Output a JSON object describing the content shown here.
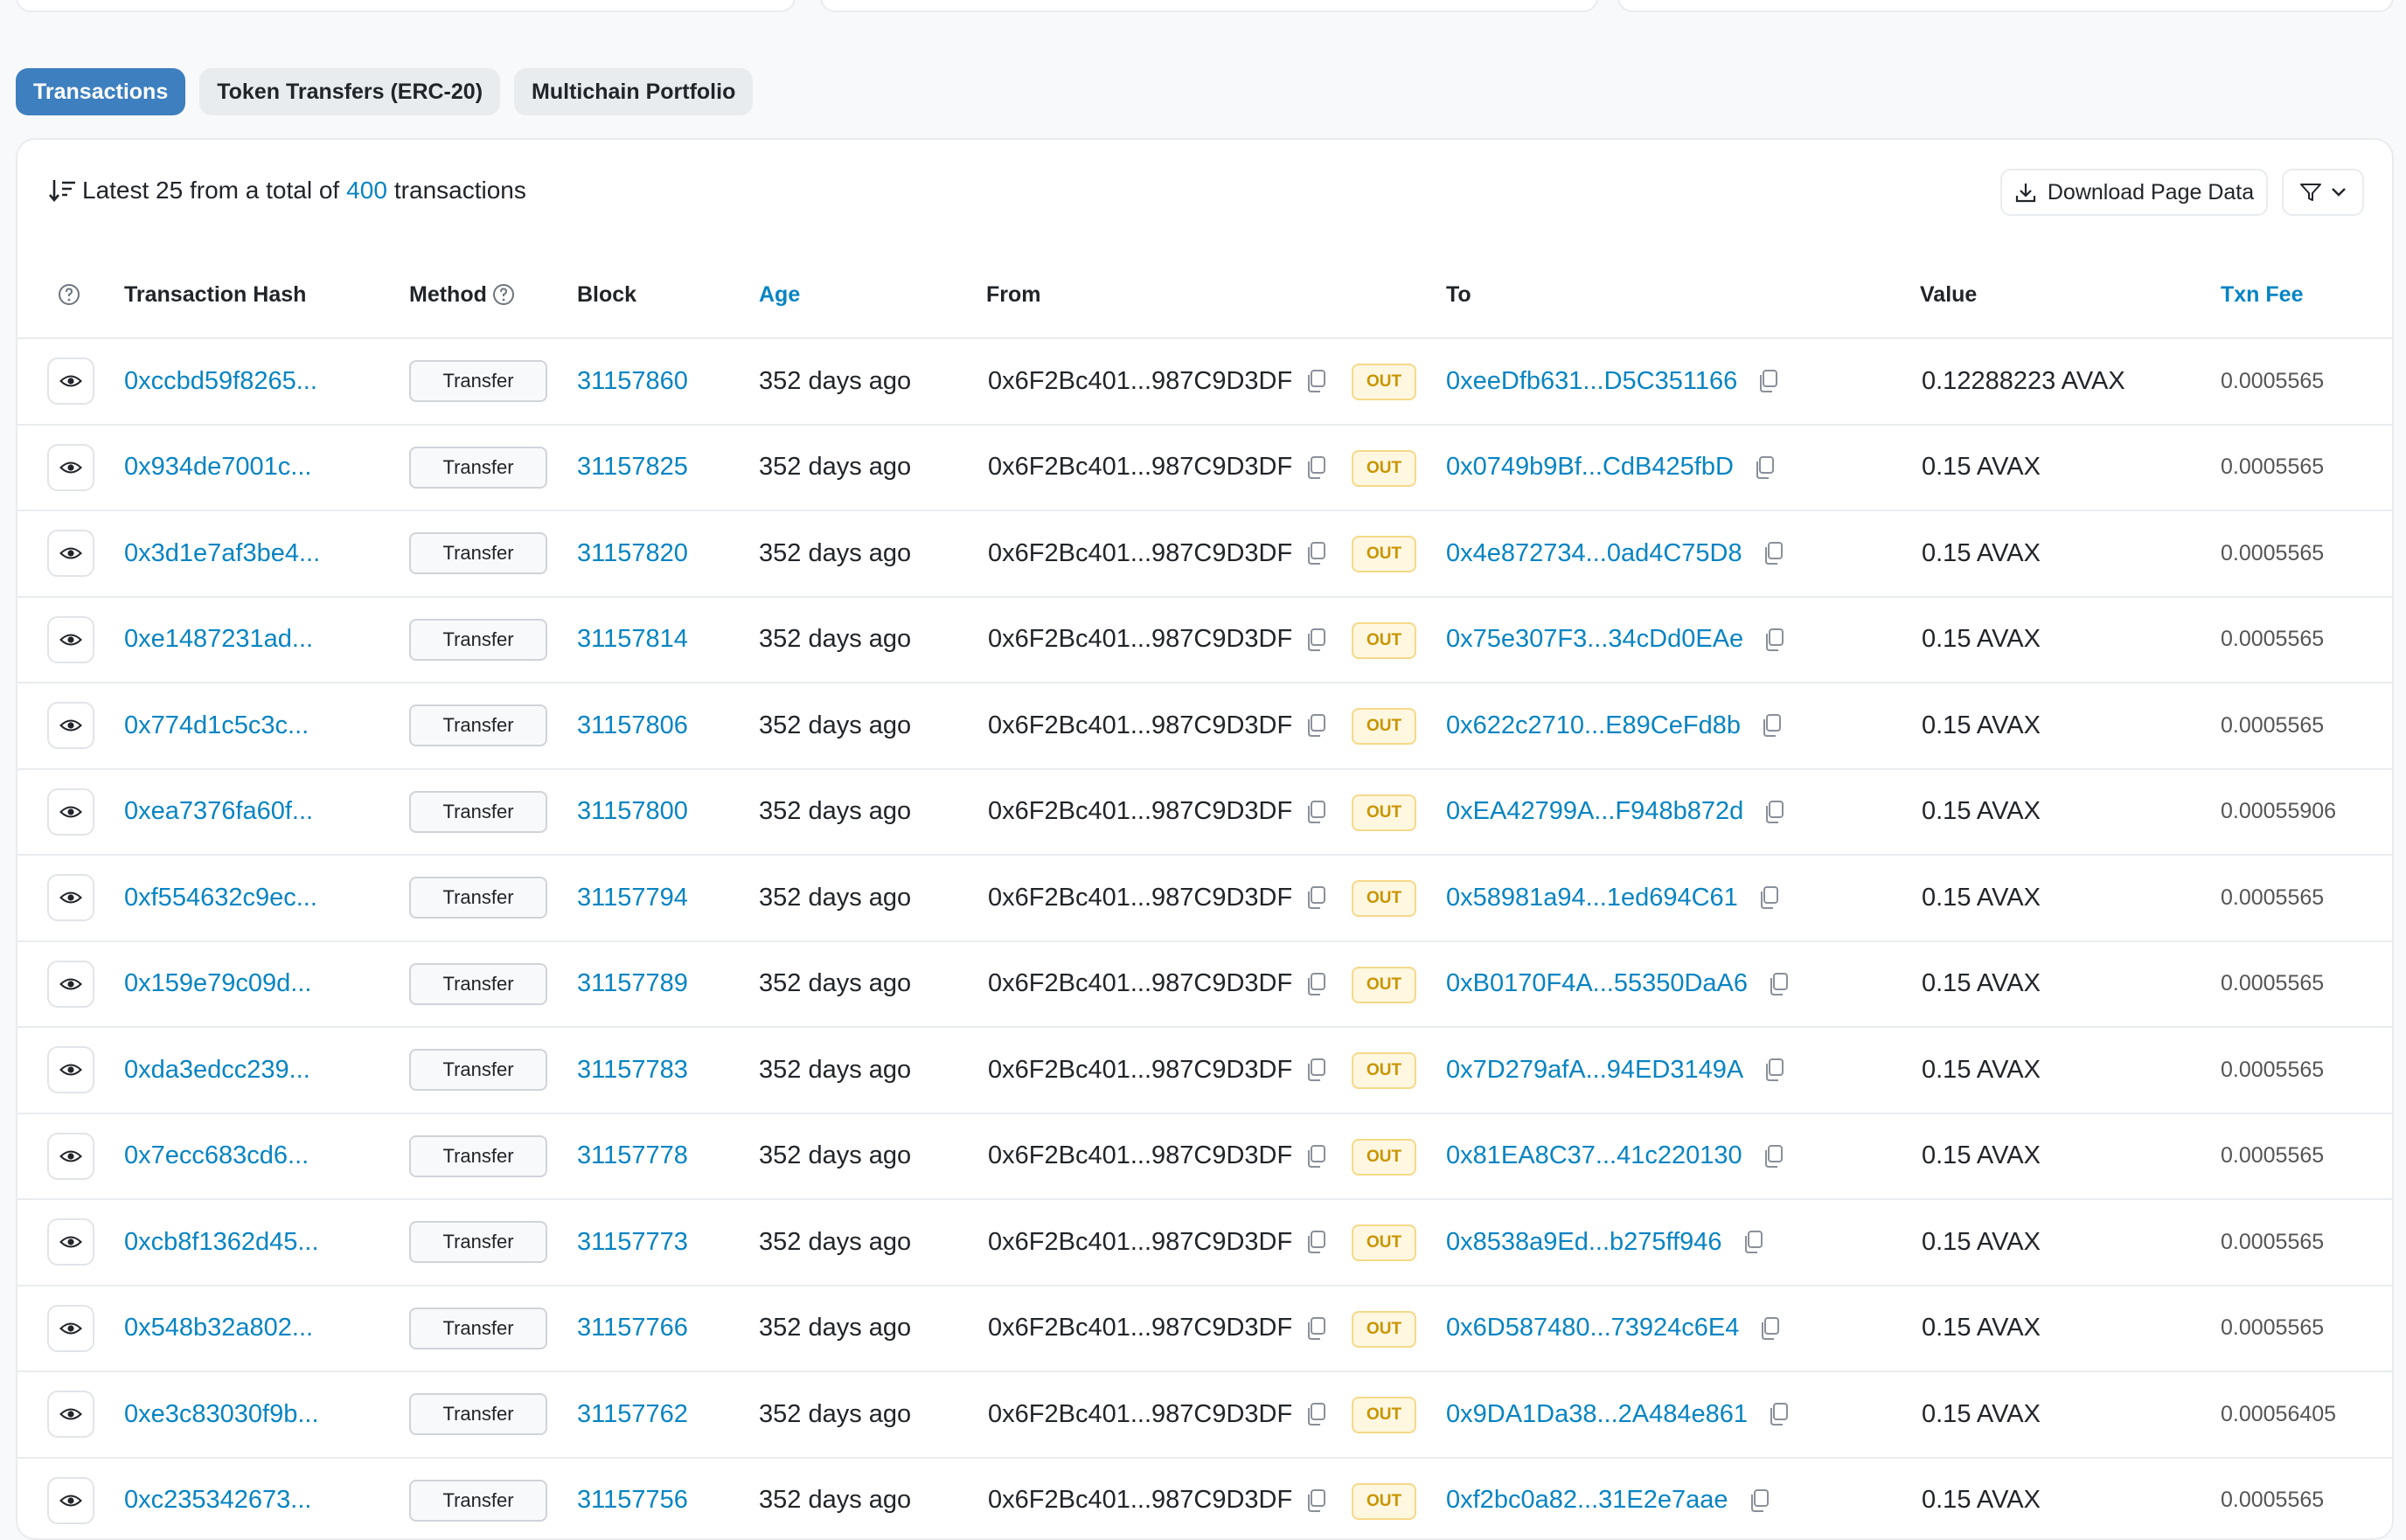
{
  "tabs": [
    {
      "label": "Transactions",
      "active": true
    },
    {
      "label": "Token Transfers (ERC-20)",
      "active": false
    },
    {
      "label": "Multichain Portfolio",
      "active": false
    }
  ],
  "summary": {
    "prefix": "Latest 25 from a total of",
    "total": "400",
    "suffix": "transactions"
  },
  "actions": {
    "download_label": "Download Page Data"
  },
  "columns": {
    "hash": "Transaction Hash",
    "method": "Method",
    "block": "Block",
    "age": "Age",
    "from": "From",
    "to": "To",
    "value": "Value",
    "fee": "Txn Fee"
  },
  "direction_label": "OUT",
  "rows": [
    {
      "hash": "0xccbd59f8265...",
      "method": "Transfer",
      "block": "31157860",
      "age": "352 days ago",
      "from": "0x6F2Bc401...987C9D3DF",
      "to": "0xeeDfb631...D5C351166",
      "value": "0.12288223 AVAX",
      "fee": "0.0005565"
    },
    {
      "hash": "0x934de7001c...",
      "method": "Transfer",
      "block": "31157825",
      "age": "352 days ago",
      "from": "0x6F2Bc401...987C9D3DF",
      "to": "0x0749b9Bf...CdB425fbD",
      "value": "0.15 AVAX",
      "fee": "0.0005565"
    },
    {
      "hash": "0x3d1e7af3be4...",
      "method": "Transfer",
      "block": "31157820",
      "age": "352 days ago",
      "from": "0x6F2Bc401...987C9D3DF",
      "to": "0x4e872734...0ad4C75D8",
      "value": "0.15 AVAX",
      "fee": "0.0005565"
    },
    {
      "hash": "0xe1487231ad...",
      "method": "Transfer",
      "block": "31157814",
      "age": "352 days ago",
      "from": "0x6F2Bc401...987C9D3DF",
      "to": "0x75e307F3...34cDd0EAe",
      "value": "0.15 AVAX",
      "fee": "0.0005565"
    },
    {
      "hash": "0x774d1c5c3c...",
      "method": "Transfer",
      "block": "31157806",
      "age": "352 days ago",
      "from": "0x6F2Bc401...987C9D3DF",
      "to": "0x622c2710...E89CeFd8b",
      "value": "0.15 AVAX",
      "fee": "0.0005565"
    },
    {
      "hash": "0xea7376fa60f...",
      "method": "Transfer",
      "block": "31157800",
      "age": "352 days ago",
      "from": "0x6F2Bc401...987C9D3DF",
      "to": "0xEA42799A...F948b872d",
      "value": "0.15 AVAX",
      "fee": "0.00055906"
    },
    {
      "hash": "0xf554632c9ec...",
      "method": "Transfer",
      "block": "31157794",
      "age": "352 days ago",
      "from": "0x6F2Bc401...987C9D3DF",
      "to": "0x58981a94...1ed694C61",
      "value": "0.15 AVAX",
      "fee": "0.0005565"
    },
    {
      "hash": "0x159e79c09d...",
      "method": "Transfer",
      "block": "31157789",
      "age": "352 days ago",
      "from": "0x6F2Bc401...987C9D3DF",
      "to": "0xB0170F4A...55350DaA6",
      "value": "0.15 AVAX",
      "fee": "0.0005565"
    },
    {
      "hash": "0xda3edcc239...",
      "method": "Transfer",
      "block": "31157783",
      "age": "352 days ago",
      "from": "0x6F2Bc401...987C9D3DF",
      "to": "0x7D279afA...94ED3149A",
      "value": "0.15 AVAX",
      "fee": "0.0005565"
    },
    {
      "hash": "0x7ecc683cd6...",
      "method": "Transfer",
      "block": "31157778",
      "age": "352 days ago",
      "from": "0x6F2Bc401...987C9D3DF",
      "to": "0x81EA8C37...41c220130",
      "value": "0.15 AVAX",
      "fee": "0.0005565"
    },
    {
      "hash": "0xcb8f1362d45...",
      "method": "Transfer",
      "block": "31157773",
      "age": "352 days ago",
      "from": "0x6F2Bc401...987C9D3DF",
      "to": "0x8538a9Ed...b275ff946",
      "value": "0.15 AVAX",
      "fee": "0.0005565"
    },
    {
      "hash": "0x548b32a802...",
      "method": "Transfer",
      "block": "31157766",
      "age": "352 days ago",
      "from": "0x6F2Bc401...987C9D3DF",
      "to": "0x6D587480...73924c6E4",
      "value": "0.15 AVAX",
      "fee": "0.0005565"
    },
    {
      "hash": "0xe3c83030f9b...",
      "method": "Transfer",
      "block": "31157762",
      "age": "352 days ago",
      "from": "0x6F2Bc401...987C9D3DF",
      "to": "0x9DA1Da38...2A484e861",
      "value": "0.15 AVAX",
      "fee": "0.00056405"
    },
    {
      "hash": "0xc235342673...",
      "method": "Transfer",
      "block": "31157756",
      "age": "352 days ago",
      "from": "0x6F2Bc401...987C9D3DF",
      "to": "0xf2bc0a82...31E2e7aae",
      "value": "0.15 AVAX",
      "fee": "0.0005565"
    }
  ],
  "icons": {
    "sort": "sort-descending-icon",
    "download": "download-icon",
    "filter": "filter-icon",
    "chevron": "chevron-down-icon",
    "help": "question-circle-icon",
    "eye": "eye-icon",
    "copy": "copy-icon"
  },
  "colors": {
    "accent": "#3d7fbf",
    "link": "#0784c3",
    "badge_out": "#c99400"
  }
}
